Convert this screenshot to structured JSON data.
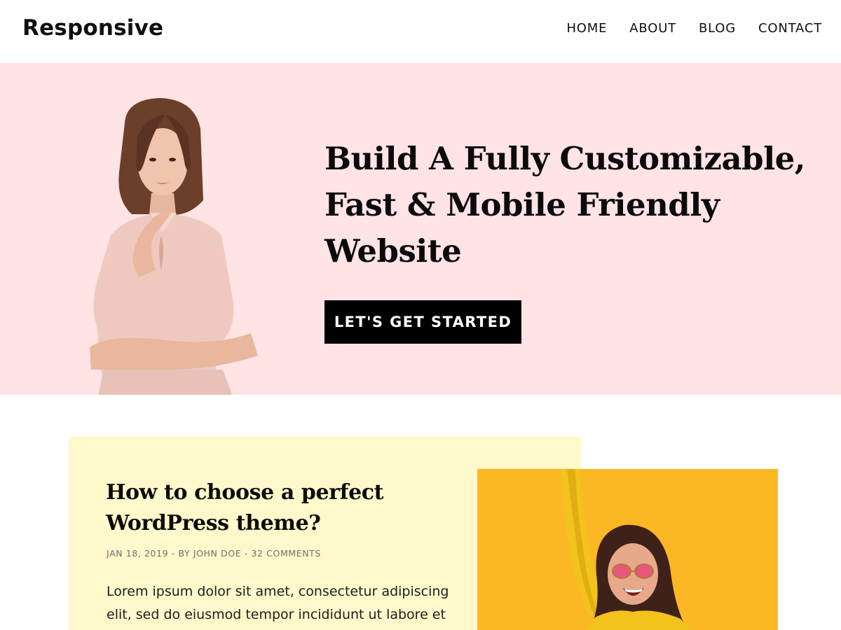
{
  "header": {
    "logo": "Responsive",
    "nav": [
      "HOME",
      "ABOUT",
      "BLOG",
      "CONTACT"
    ]
  },
  "hero": {
    "title_lines": [
      "Build A Fully Customizable,",
      "Fast & Mobile Friendly",
      "Website"
    ],
    "cta_label": "LET'S GET STARTED",
    "background_color": "#ffe3e5"
  },
  "post": {
    "title_lines": [
      "How to choose a perfect",
      "WordPress theme?"
    ],
    "date": "JAN 18, 2019",
    "separator": "-",
    "author": "BY JOHN DOE",
    "comments": "32 COMMENTS",
    "excerpt_lines": [
      "Lorem ipsum dolor sit amet, consectetur adipiscing",
      "elit, sed do eiusmod tempor incididunt ut labore et"
    ],
    "card_color": "#fff8cb",
    "image_color": "#fcb724"
  }
}
